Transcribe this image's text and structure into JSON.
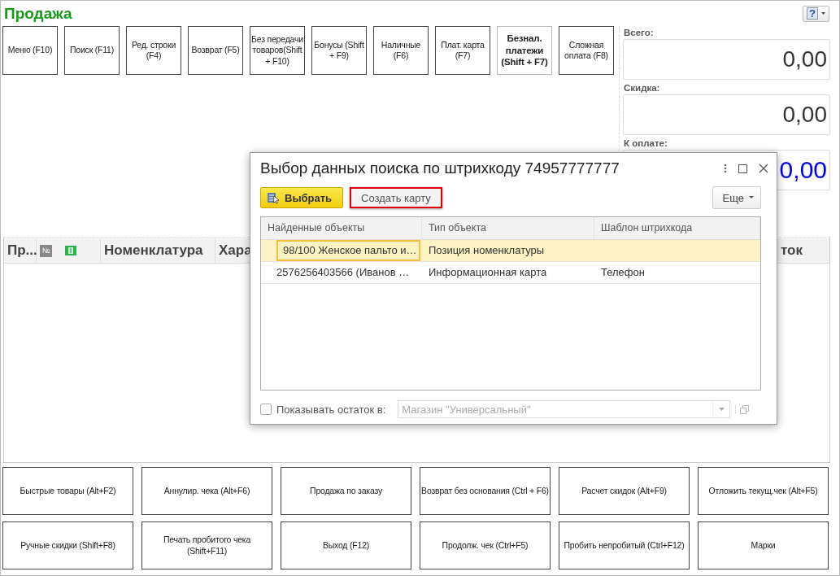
{
  "window": {
    "title": "Продажа"
  },
  "help_button": {
    "label": "?"
  },
  "top_buttons": [
    {
      "label": "Меню (F10)",
      "default": false
    },
    {
      "label": "Поиск (F11)",
      "default": false
    },
    {
      "label": "Ред. строки (F4)",
      "default": false
    },
    {
      "label": "Возврат (F5)",
      "default": false
    },
    {
      "label": "Без передачи товаров(Shift + F10)",
      "default": false
    },
    {
      "label": "Бонусы (Shift + F9)",
      "default": false
    },
    {
      "label": "Наличные (F6)",
      "default": false
    },
    {
      "label": "Плат. карта (F7)",
      "default": false
    },
    {
      "label": "Безнал. платежи (Shift + F7)",
      "default": true
    },
    {
      "label": "Сложная оплата (F8)",
      "default": false
    }
  ],
  "totals": [
    {
      "label": "Всего:",
      "value": "0,00",
      "kind": "plain"
    },
    {
      "label": "Скидка:",
      "value": "0,00",
      "kind": "plain"
    },
    {
      "label": "К оплате:",
      "value": "0,00",
      "kind": "due"
    }
  ],
  "table": {
    "columns": [
      {
        "label": "Пр...",
        "kind": "text"
      },
      {
        "label": "№",
        "kind": "badge"
      },
      {
        "kind": "money-icon"
      },
      {
        "label": "Номенклатура",
        "kind": "text"
      },
      {
        "label": "Хара",
        "kind": "text"
      },
      {
        "label": "ток",
        "kind": "text"
      }
    ]
  },
  "bottom_buttons": [
    "Быстрые товары (Alt+F2)",
    "Аннулир. чека (Alt+F6)",
    "Продажа по заказу",
    "Возврат без основания (Ctrl + F6)",
    "Расчет скидок (Alt+F9)",
    "Отложить текущ.чек (Alt+F5)",
    "Ручные скидки (Shift+F8)",
    "Печать пробитого чека (Shift+F11)",
    "Выход (F12)",
    "Продолж. чек (Ctrl+F5)",
    "Пробить непробитый (Ctrl+F12)",
    "Марки"
  ],
  "dialog": {
    "title": "Выбор данных поиска по штрихкоду 74957777777",
    "actions": [
      {
        "label": "Выбрать",
        "kind": "primary"
      },
      {
        "label": "Создать карту",
        "kind": "marked"
      }
    ],
    "more_button": "Еще",
    "grid": {
      "columns": [
        "Найденные объекты",
        "Тип объекта",
        "Шаблон штрихкода"
      ],
      "rows": [
        {
          "cells": [
            "98/100 Женское пальто и…",
            "Позиция номенклатуры",
            ""
          ],
          "selected": true
        },
        {
          "cells": [
            "2576256403566 (Иванов …",
            "Информационная карта",
            "Телефон"
          ],
          "selected": false
        }
      ]
    },
    "show_stock": {
      "label": "Показывать остаток в:",
      "checked": false,
      "value": "Магазин \"Универсальный\"",
      "disabled": true
    }
  }
}
